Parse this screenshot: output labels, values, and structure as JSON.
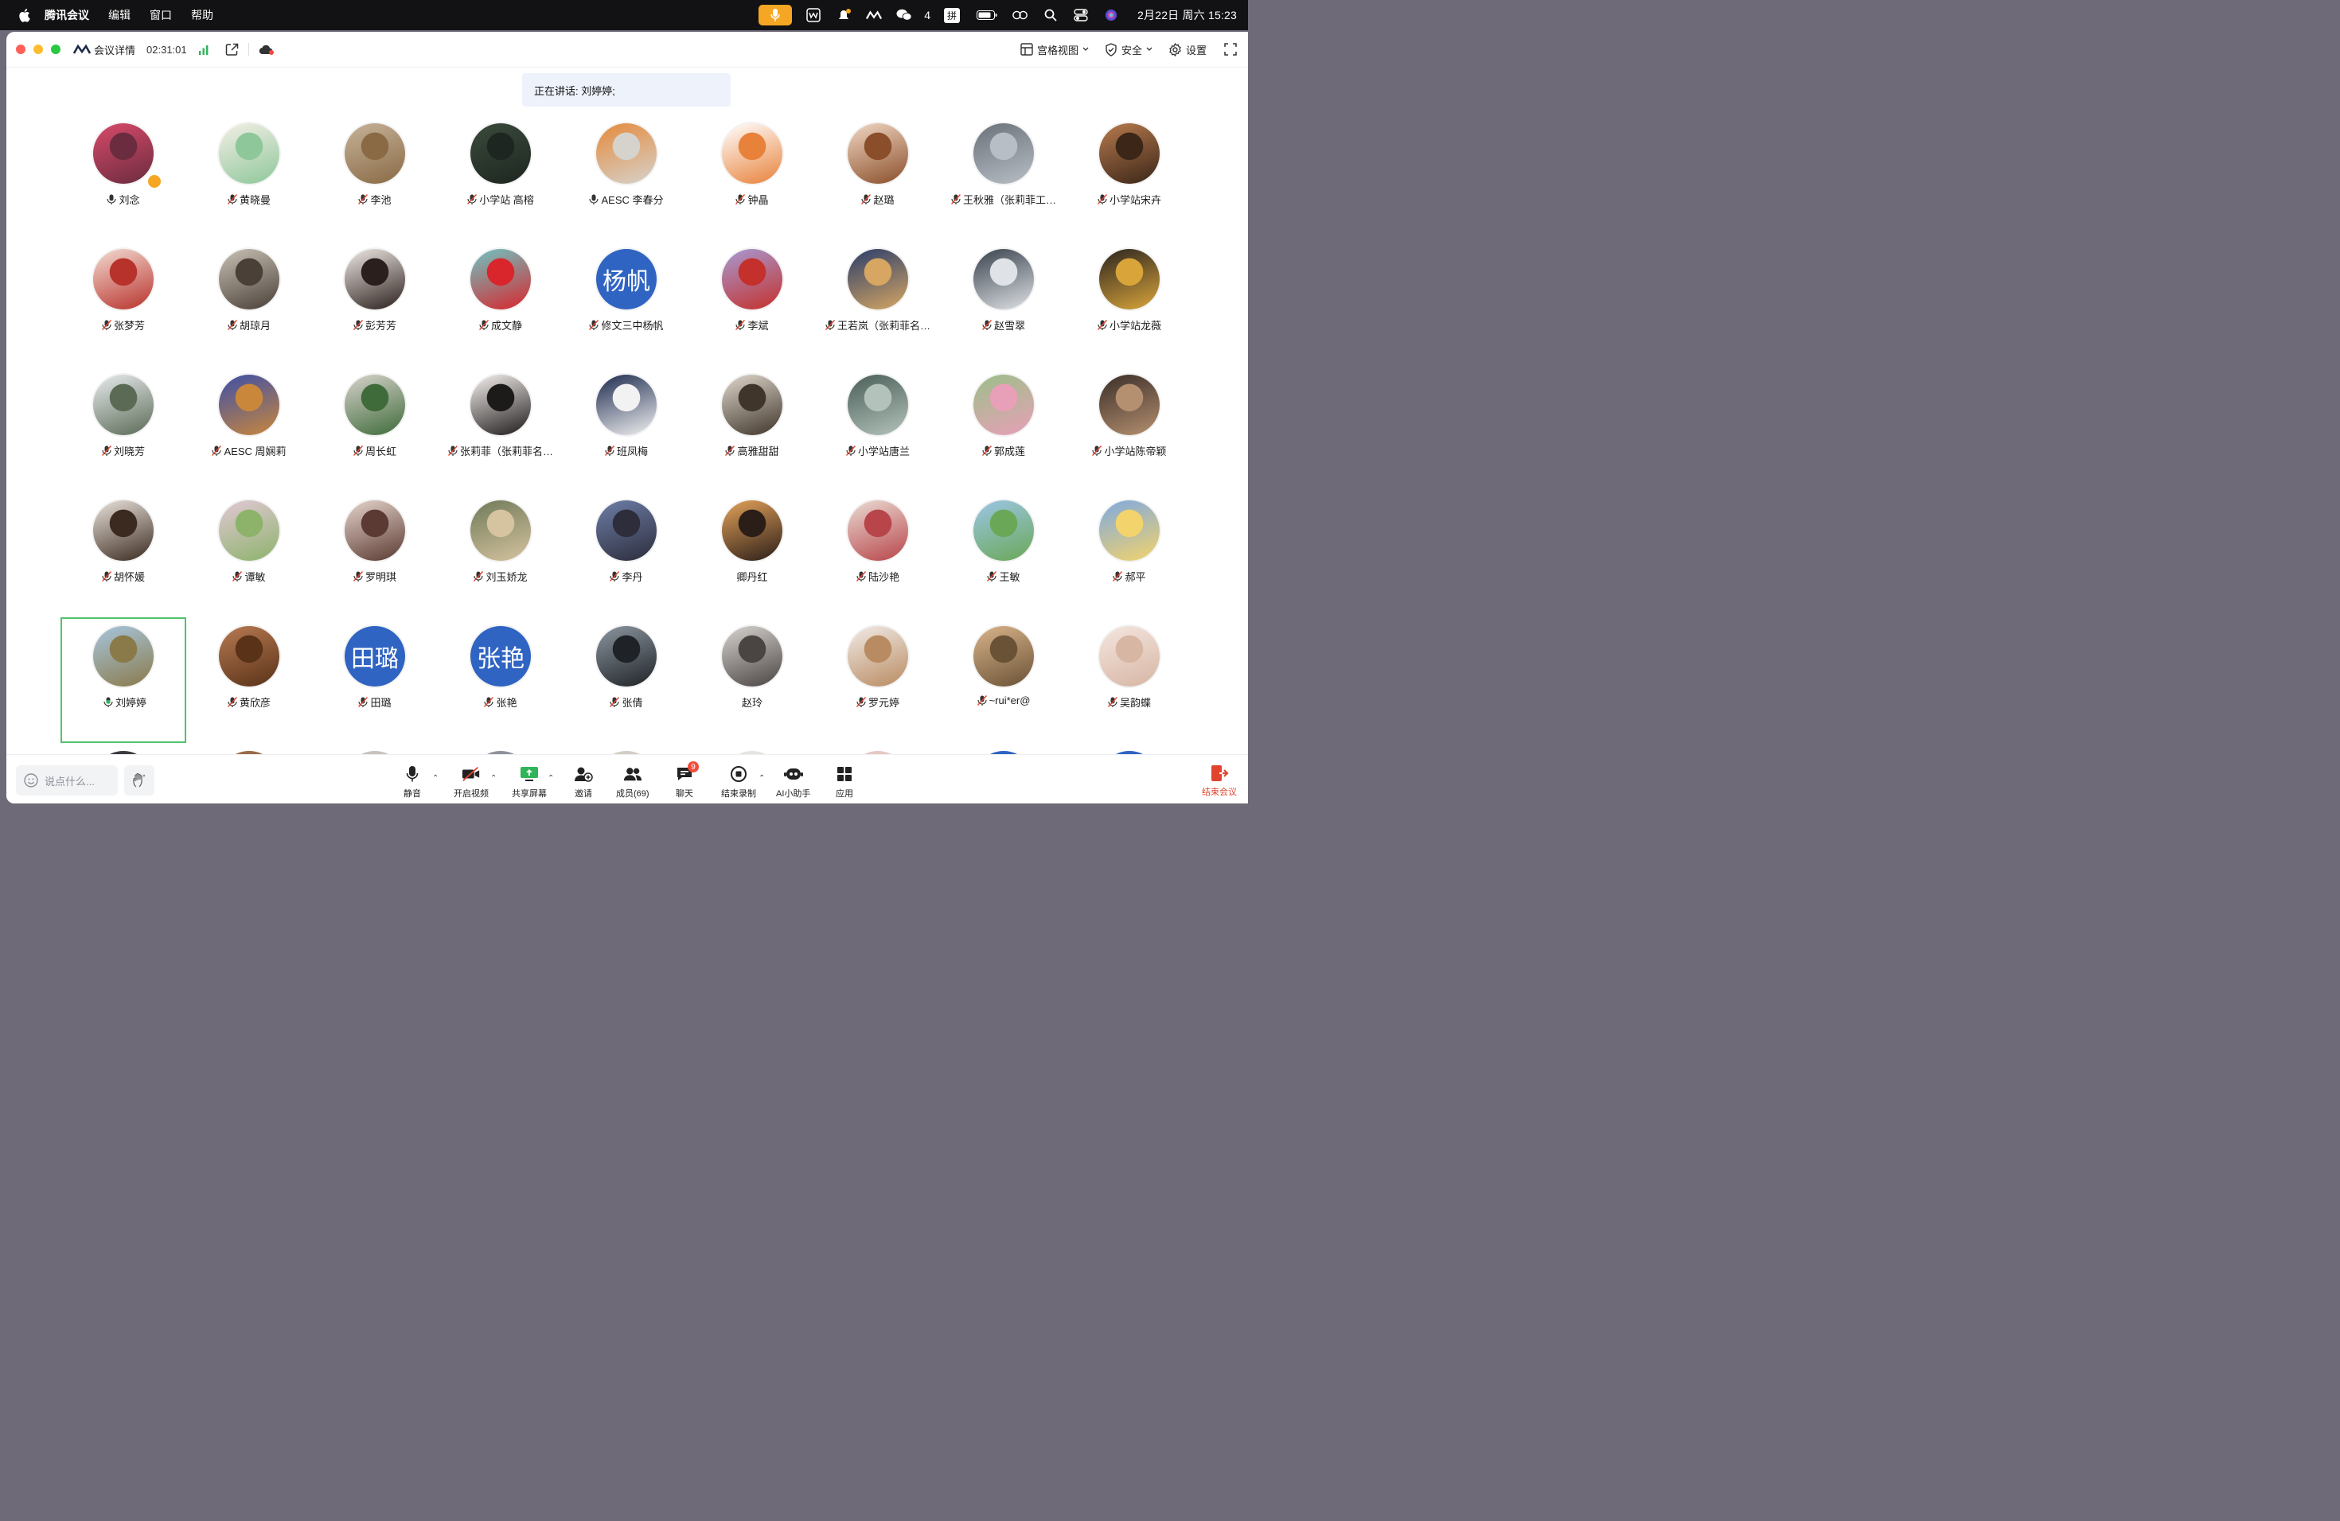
{
  "menubar": {
    "app_name": "腾讯会议",
    "menus": [
      "编辑",
      "窗口",
      "帮助"
    ],
    "wechat_count": "4",
    "input_method": "拼",
    "datetime": "2月22日 周六 15:23"
  },
  "titlebar": {
    "meeting_info_label": "会议详情",
    "elapsed": "02:31:01",
    "view_label": "宫格视图",
    "security_label": "安全",
    "settings_label": "设置"
  },
  "speaking": {
    "text": "正在讲话: 刘婷婷;"
  },
  "participants": [
    {
      "name": "刘念",
      "mic": "on",
      "host": true,
      "colors": [
        "#d84a6a",
        "#6b2c3f"
      ]
    },
    {
      "name": "黄晓曼",
      "mic": "off",
      "colors": [
        "#f4efe6",
        "#8ec79a"
      ]
    },
    {
      "name": "李池",
      "mic": "off",
      "colors": [
        "#c6b39a",
        "#8a6a45"
      ]
    },
    {
      "name": "小学站 高榕",
      "mic": "off",
      "colors": [
        "#3b4a3c",
        "#1d2620"
      ]
    },
    {
      "name": "AESC 李春分",
      "mic": "on",
      "colors": [
        "#e58a3b",
        "#d6d2cc"
      ]
    },
    {
      "name": "钟晶",
      "mic": "off",
      "colors": [
        "#ffffff",
        "#e8823a"
      ]
    },
    {
      "name": "赵璐",
      "mic": "off",
      "colors": [
        "#f2d7c4",
        "#8a4f2a"
      ]
    },
    {
      "name": "王秋雅（张莉菲工…",
      "mic": "off",
      "colors": [
        "#6b7179",
        "#b8bec6"
      ]
    },
    {
      "name": "小学站宋卉",
      "mic": "off",
      "colors": [
        "#b77a4e",
        "#3b2618"
      ]
    },
    {
      "name": "张梦芳",
      "mic": "off",
      "colors": [
        "#f3dcd2",
        "#b8322c"
      ]
    },
    {
      "name": "胡琼月",
      "mic": "off",
      "colors": [
        "#c9c1b5",
        "#4a4038"
      ]
    },
    {
      "name": "彭芳芳",
      "mic": "off",
      "colors": [
        "#efe9e4",
        "#2a1f1c"
      ]
    },
    {
      "name": "成文静",
      "mic": "off",
      "colors": [
        "#6ec5c4",
        "#d8262c"
      ]
    },
    {
      "name": "修文三中杨帆",
      "mic": "off",
      "text_avatar": "杨帆",
      "colors": [
        "#2f64c2",
        "#2f64c2"
      ]
    },
    {
      "name": "李斌",
      "mic": "off",
      "colors": [
        "#a79ad3",
        "#c4302b"
      ]
    },
    {
      "name": "王若岚（张莉菲名…",
      "mic": "off",
      "colors": [
        "#2a3d6b",
        "#d6a662"
      ]
    },
    {
      "name": "赵雪翠",
      "mic": "off",
      "colors": [
        "#39424d",
        "#dfe2e6"
      ]
    },
    {
      "name": "小学站龙薇",
      "mic": "off",
      "colors": [
        "#2b2420",
        "#d9a53a"
      ]
    },
    {
      "name": "刘晓芳",
      "mic": "off",
      "colors": [
        "#e8ecef",
        "#5b6a55"
      ]
    },
    {
      "name": "AESC 周娴莉",
      "mic": "off",
      "colors": [
        "#3d4fa8",
        "#c9873b"
      ]
    },
    {
      "name": "周长虹",
      "mic": "off",
      "colors": [
        "#d7d3cc",
        "#3f6b3a"
      ]
    },
    {
      "name": "张莉菲（张莉菲名…",
      "mic": "off",
      "colors": [
        "#f7f2ef",
        "#1d1a1a"
      ]
    },
    {
      "name": "班凤梅",
      "mic": "off",
      "colors": [
        "#1d2b4f",
        "#f2f2f2"
      ]
    },
    {
      "name": "高雅甜甜",
      "mic": "off",
      "colors": [
        "#e0d8cc",
        "#3f352b"
      ]
    },
    {
      "name": "小学站唐兰",
      "mic": "off",
      "colors": [
        "#4a5e57",
        "#b3c3bb"
      ]
    },
    {
      "name": "郭成莲",
      "mic": "off",
      "colors": [
        "#9bbf88",
        "#e8a0b8"
      ]
    },
    {
      "name": "小学站陈帝颖",
      "mic": "off",
      "colors": [
        "#3a2e28",
        "#b59070"
      ]
    },
    {
      "name": "胡怀媛",
      "mic": "off",
      "colors": [
        "#eae4dc",
        "#3b2a20"
      ]
    },
    {
      "name": "谭敏",
      "mic": "off",
      "colors": [
        "#e2c8d6",
        "#8db36b"
      ]
    },
    {
      "name": "罗明琪",
      "mic": "off",
      "colors": [
        "#e6d4cc",
        "#5a3a32"
      ]
    },
    {
      "name": "刘玉娇龙",
      "mic": "off",
      "colors": [
        "#6f7a58",
        "#d6c3a0"
      ]
    },
    {
      "name": "李丹",
      "mic": "off",
      "colors": [
        "#6d7ea8",
        "#2d2d3b"
      ]
    },
    {
      "name": "卿丹红",
      "mic": "none",
      "colors": [
        "#e4a25a",
        "#2b1e18"
      ]
    },
    {
      "name": "陆沙艳",
      "mic": "off",
      "colors": [
        "#eadcd4",
        "#b8454a"
      ]
    },
    {
      "name": "王敏",
      "mic": "off",
      "colors": [
        "#9cc6e6",
        "#6aa857"
      ]
    },
    {
      "name": "郝平",
      "mic": "off",
      "colors": [
        "#7ea9e0",
        "#f3d36b"
      ]
    },
    {
      "name": "刘婷婷",
      "mic": "speaking",
      "active": true,
      "colors": [
        "#a7c6de",
        "#8a7a4a"
      ]
    },
    {
      "name": "黄欣彦",
      "mic": "off",
      "colors": [
        "#b77a52",
        "#5a3218"
      ]
    },
    {
      "name": "田璐",
      "mic": "off",
      "text_avatar": "田璐",
      "colors": [
        "#2f64c2",
        "#2f64c2"
      ]
    },
    {
      "name": "张艳",
      "mic": "off",
      "text_avatar": "张艳",
      "colors": [
        "#2f64c2",
        "#2f64c2"
      ]
    },
    {
      "name": "张倩",
      "mic": "off",
      "colors": [
        "#8c96a0",
        "#1f2327"
      ]
    },
    {
      "name": "赵玲",
      "mic": "none",
      "colors": [
        "#d8d4d0",
        "#4a4442"
      ]
    },
    {
      "name": "罗元婷",
      "mic": "off",
      "colors": [
        "#f1ebe6",
        "#b98b62"
      ]
    },
    {
      "name": "~rui*er@",
      "mic": "off",
      "colors": [
        "#d9b48a",
        "#6a5236"
      ]
    },
    {
      "name": "吴韵蝶",
      "mic": "off",
      "colors": [
        "#f4e6df",
        "#d7b6a4"
      ]
    }
  ],
  "toolbar": {
    "chat_placeholder": "说点什么...",
    "mute": "静音",
    "video": "开启视频",
    "share": "共享屏幕",
    "invite": "邀请",
    "members": "成员(69)",
    "chat": "聊天",
    "chat_badge": "9",
    "record": "结束录制",
    "ai": "AI小助手",
    "apps": "应用",
    "end": "结束会议"
  },
  "colors": {
    "accent_blue": "#2f64c2",
    "active_border": "#52c26a",
    "end_red": "#e0442e",
    "menubar_mic": "#f5a623"
  }
}
